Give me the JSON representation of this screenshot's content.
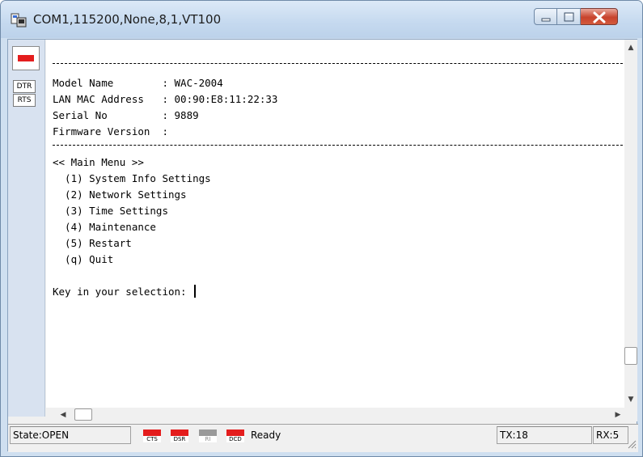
{
  "window": {
    "title": "COM1,115200,None,8,1,VT100"
  },
  "side_panel": {
    "dtr_label": "DTR",
    "rts_label": "RTS"
  },
  "terminal": {
    "lines": [
      "Model Name        : WAC-2004",
      "LAN MAC Address   : 00:90:E8:11:22:33",
      "Serial No         : 9889",
      "Firmware Version  :",
      "<< Main Menu >>",
      "  (1) System Info Settings",
      "  (2) Network Settings",
      "  (3) Time Settings",
      "  (4) Maintenance",
      "  (5) Restart",
      "  (q) Quit",
      "Key in your selection: "
    ]
  },
  "statusbar": {
    "state": "State:OPEN",
    "signals": [
      "CTS",
      "DSR",
      "RI",
      "DCD"
    ],
    "status": "Ready",
    "tx": "TX:18",
    "rx": "RX:5"
  },
  "colors": {
    "led_active": "#e41d1d",
    "led_inactive": "#9a9a9a"
  }
}
